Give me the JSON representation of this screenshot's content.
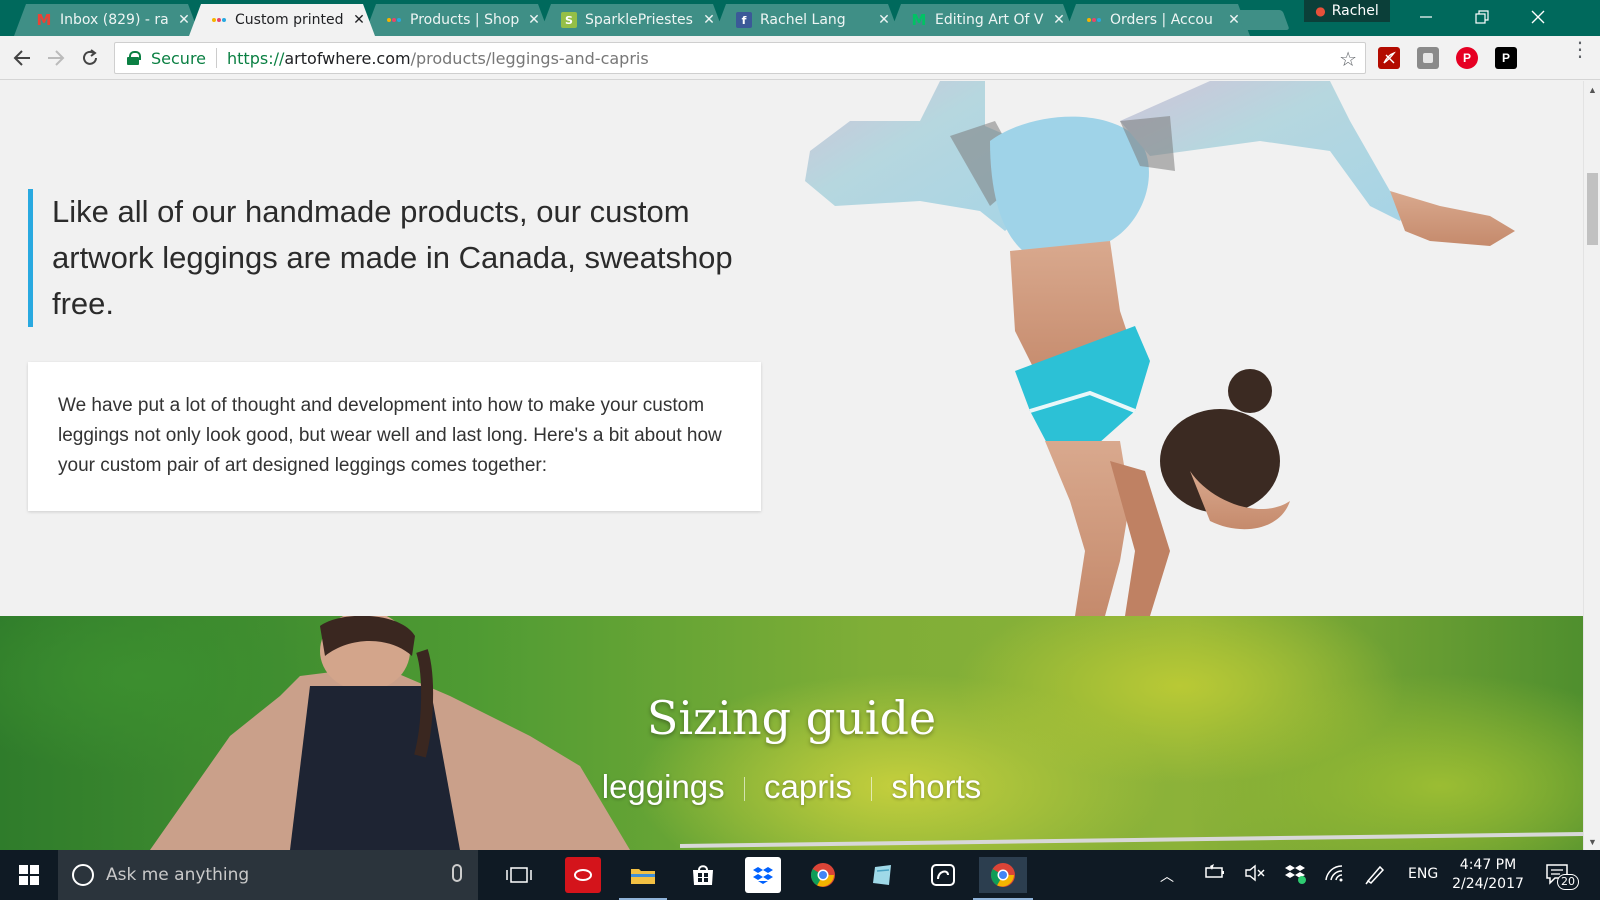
{
  "browser": {
    "tabs": [
      {
        "title": "Inbox (829) - ra",
        "icon": "gmail-icon",
        "active": false
      },
      {
        "title": "Custom printed",
        "icon": "artofwhere-icon",
        "active": true
      },
      {
        "title": "Products | Shop",
        "icon": "artofwhere-icon",
        "active": false
      },
      {
        "title": "SparklePriestes",
        "icon": "shopify-icon",
        "active": false
      },
      {
        "title": "Rachel Lang",
        "icon": "facebook-icon",
        "active": false
      },
      {
        "title": "Editing Art Of V",
        "icon": "medium-icon",
        "active": false
      },
      {
        "title": "Orders | Accou",
        "icon": "artofwhere-icon",
        "active": false
      }
    ],
    "profile_name": "Rachel",
    "address": {
      "secure_label": "Secure",
      "scheme": "https://",
      "host": "artofwhere.com",
      "path": "/products/leggings-and-capris"
    },
    "extensions": [
      "adobe-acrobat-icon",
      "ghostery-icon",
      "pinterest-icon",
      "pocket-icon"
    ],
    "colors": {
      "frame": "#00695c",
      "secure": "#0b8043"
    }
  },
  "page": {
    "quote": "Like all of our handmade products, our custom artwork leggings are made in Canada, sweatshop free.",
    "intro": "We have put a lot of thought and development into how to make your custom leggings not only look good, but wear well and last long. Here's a bit about how your custom pair of art designed leggings comes together:",
    "sizing": {
      "title": "Sizing guide",
      "links": [
        "leggings",
        "capris",
        "shorts"
      ]
    },
    "colors": {
      "accent_bar": "#29a9e0"
    }
  },
  "taskbar": {
    "search_placeholder": "Ask me anything",
    "language": "ENG",
    "time": "4:47 PM",
    "date": "2/24/2017",
    "notifications": "20"
  }
}
